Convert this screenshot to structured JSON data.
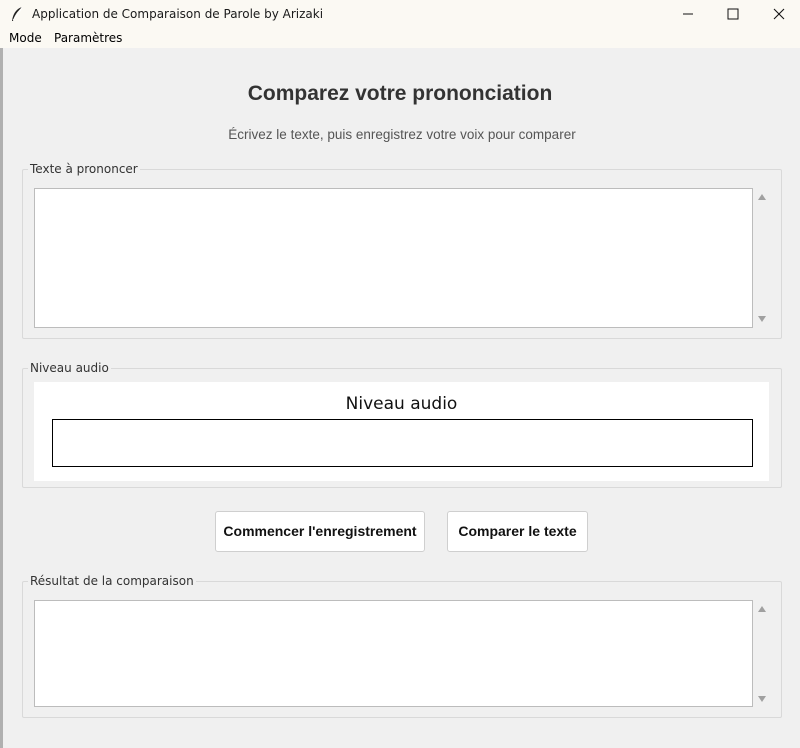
{
  "window": {
    "title": "Application de Comparaison de Parole by Arizaki",
    "controls": [
      "minimize",
      "maximize",
      "close"
    ]
  },
  "menu": {
    "items": [
      "Mode",
      "Paramètres"
    ]
  },
  "header": {
    "title": "Comparez votre prononciation",
    "subtitle": "Écrivez le texte, puis enregistrez votre voix pour comparer"
  },
  "text_section": {
    "label": "Texte à prononcer",
    "value": ""
  },
  "audio_section": {
    "label": "Niveau audio",
    "meter_title": "Niveau audio",
    "level": 0
  },
  "buttons": {
    "record": "Commencer l'enregistrement",
    "compare": "Comparer le texte"
  },
  "result_section": {
    "label": "Résultat de la comparaison",
    "value": ""
  }
}
